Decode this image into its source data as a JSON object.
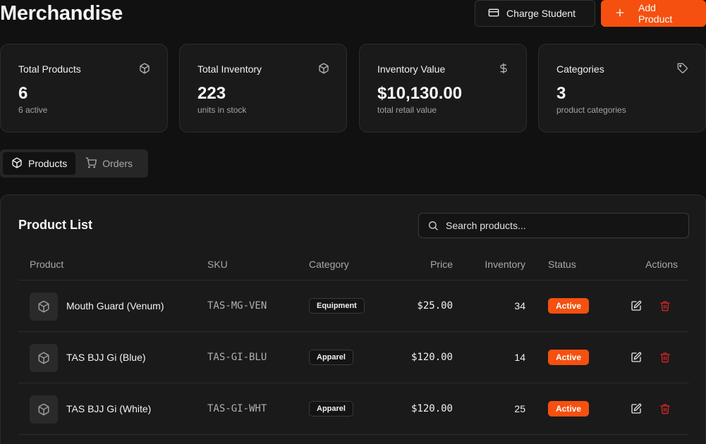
{
  "header": {
    "title": "Merchandise",
    "charge_label": "Charge Student",
    "add_label": "Add Product",
    "accent_color": "#f5500f"
  },
  "stats": [
    {
      "label": "Total Products",
      "value": "6",
      "sub": "6 active",
      "icon": "box-icon"
    },
    {
      "label": "Total Inventory",
      "value": "223",
      "sub": "units in stock",
      "icon": "box-icon"
    },
    {
      "label": "Inventory Value",
      "value": "$10,130.00",
      "sub": "total retail value",
      "icon": "dollar-icon"
    },
    {
      "label": "Categories",
      "value": "3",
      "sub": "product categories",
      "icon": "tag-icon"
    }
  ],
  "tabs": [
    {
      "label": "Products",
      "icon": "box-icon",
      "active": true
    },
    {
      "label": "Orders",
      "icon": "cart-icon",
      "active": false
    }
  ],
  "product_list": {
    "title": "Product List",
    "search_placeholder": "Search products...",
    "columns": [
      "Product",
      "SKU",
      "Category",
      "Price",
      "Inventory",
      "Status",
      "Actions"
    ],
    "rows": [
      {
        "name": "Mouth Guard (Venum)",
        "sku": "TAS-MG-VEN",
        "category": "Equipment",
        "price": "$25.00",
        "inventory": "34",
        "status": "Active"
      },
      {
        "name": "TAS BJJ Gi (Blue)",
        "sku": "TAS-GI-BLU",
        "category": "Apparel",
        "price": "$120.00",
        "inventory": "14",
        "status": "Active"
      },
      {
        "name": "TAS BJJ Gi (White)",
        "sku": "TAS-GI-WHT",
        "category": "Apparel",
        "price": "$120.00",
        "inventory": "25",
        "status": "Active"
      }
    ]
  }
}
